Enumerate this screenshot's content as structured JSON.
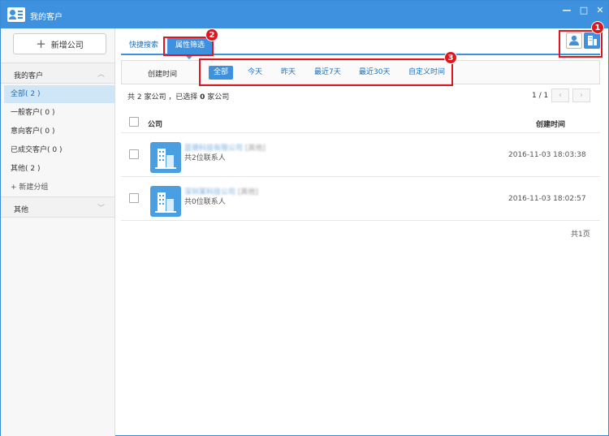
{
  "window": {
    "title": "我的客户",
    "controls": [
      "—",
      "□",
      "✕"
    ]
  },
  "sidebar": {
    "add_button": "新增公司",
    "groups": [
      {
        "label": "我的客户",
        "chevron": "︿"
      },
      {
        "label": "其他",
        "chevron": "﹀"
      }
    ],
    "items": [
      {
        "label": "全部( 2 )",
        "active": true
      },
      {
        "label": "一般客户( 0 )"
      },
      {
        "label": "意向客户( 0 )"
      },
      {
        "label": "已成交客户( 0 )"
      },
      {
        "label": "其他( 2 )"
      }
    ],
    "new_group": "+ 新建分组"
  },
  "tabs": [
    {
      "label": "快捷搜索"
    },
    {
      "label": "属性筛选",
      "active": true
    }
  ],
  "filter": {
    "label": "创建时间",
    "options": [
      "全部",
      "今天",
      "昨天",
      "最近7天",
      "最近30天",
      "自定义时间"
    ],
    "selected": "全部"
  },
  "summary": {
    "prefix": "共 2 家公司 ，已选择 ",
    "selected_count": "0",
    "suffix": " 家公司"
  },
  "pager": {
    "text": "1 / 1",
    "prev": "‹",
    "next": "›"
  },
  "table": {
    "headers": {
      "company": "公司",
      "created": "创建时间"
    },
    "rows": [
      {
        "name": "蓝德科技有限公司",
        "tag": "[其他]",
        "contacts": "共2位联系人",
        "created": "2016-11-03 18:03:38"
      },
      {
        "name": "深圳某科技公司",
        "tag": "[其他]",
        "contacts": "共0位联系人",
        "created": "2016-11-03 18:02:57"
      }
    ],
    "footer": "共1页"
  },
  "annotations": [
    "1",
    "2",
    "3"
  ],
  "colors": {
    "accent": "#3d91de",
    "annotation": "#e0161f",
    "active_bg": "#cfe6f7"
  }
}
